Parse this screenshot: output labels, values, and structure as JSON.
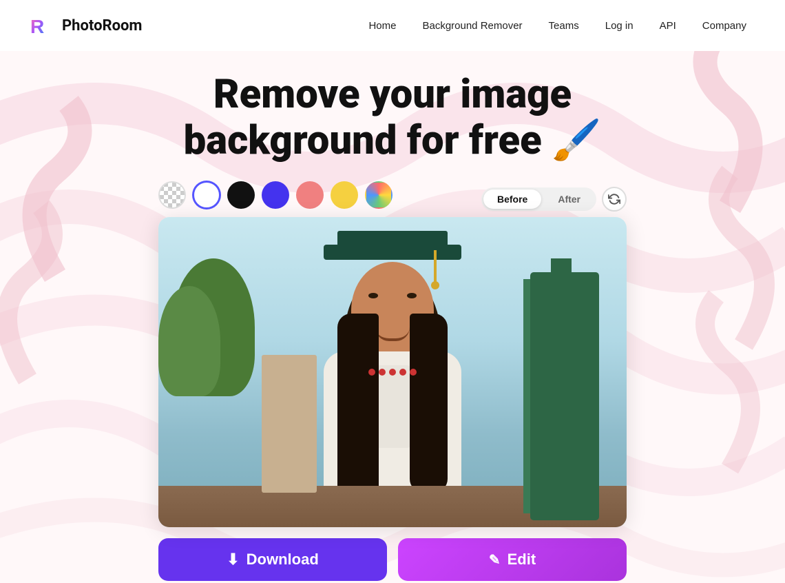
{
  "navbar": {
    "logo_text": "PhotoRoom",
    "links": [
      {
        "label": "Home",
        "key": "home"
      },
      {
        "label": "Background Remover",
        "key": "bg-remover"
      },
      {
        "label": "Teams",
        "key": "teams"
      },
      {
        "label": "Log in",
        "key": "login"
      },
      {
        "label": "API",
        "key": "api"
      },
      {
        "label": "Company",
        "key": "company"
      }
    ]
  },
  "hero": {
    "title_line1": "Remove your image",
    "title_line2": "background for free 🖌️"
  },
  "editor": {
    "swatches": [
      {
        "label": "transparent",
        "color": "transparent",
        "active": false
      },
      {
        "label": "white ring",
        "color": "#ffffff",
        "active": true
      },
      {
        "label": "black",
        "color": "#111111",
        "active": false
      },
      {
        "label": "purple",
        "color": "#4433ee",
        "active": false
      },
      {
        "label": "pink",
        "color": "#f08080",
        "active": false
      },
      {
        "label": "yellow",
        "color": "#f5d040",
        "active": false
      },
      {
        "label": "multicolor",
        "color": "multi",
        "active": false
      }
    ],
    "toggle": {
      "before_label": "Before",
      "after_label": "After",
      "active": "before"
    },
    "buttons": {
      "download_label": "Download",
      "edit_label": "Edit",
      "download_icon": "⬇",
      "edit_icon": "✎"
    }
  }
}
